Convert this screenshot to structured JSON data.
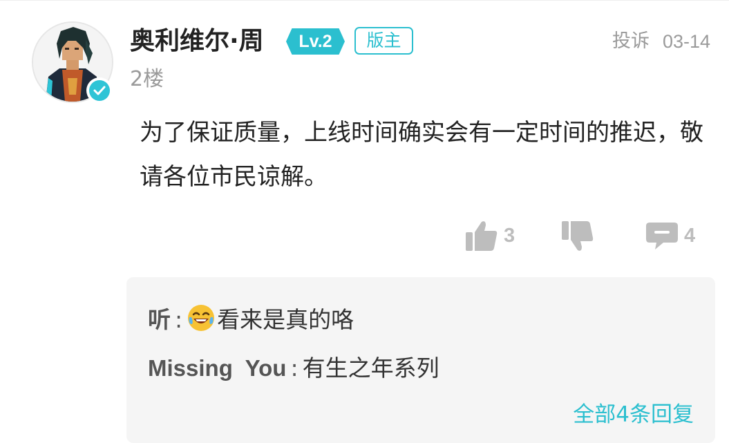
{
  "post": {
    "username": "奥利维尔·周",
    "level": "Lv.2",
    "role": "版主",
    "floor": "2楼",
    "report_label": "投诉",
    "date": "03-14",
    "content": "为了保证质量，上线时间确实会有一定时间的推迟，敬请各位市民谅解。"
  },
  "actions": {
    "likes": "3",
    "dislikes": "",
    "comments": "4"
  },
  "replies": {
    "items": [
      {
        "name": "听",
        "text": "看来是真的咯",
        "emoji": "laughing-tears-emoji"
      },
      {
        "name": "Missing  You",
        "text": "有生之年系列"
      }
    ],
    "more_label": "全部4条回复"
  },
  "colors": {
    "accent": "#2bbfcf",
    "muted": "#9a9a9a",
    "icon_gray": "#bdbdbd",
    "reply_bg": "#f5f5f5"
  }
}
